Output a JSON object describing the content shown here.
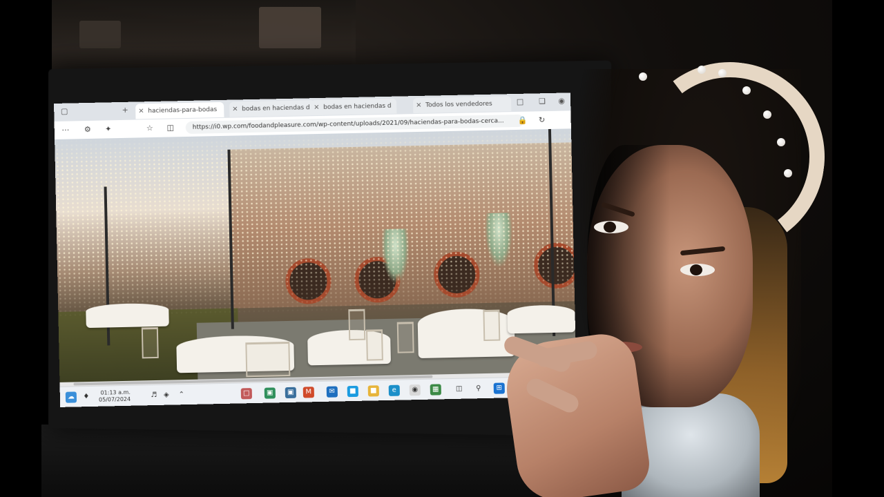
{
  "scene": {
    "description_type": "photo of a person holding a laptop displaying a browser",
    "background_color": "#0b0907"
  },
  "browser": {
    "tabs": [
      {
        "label": "haciendas-para-bodas",
        "close": "×",
        "active": true
      },
      {
        "label": "bodas en haciendas d",
        "close": "×",
        "active": false
      },
      {
        "label": "bodas en haciendas d",
        "close": "×",
        "active": false
      },
      {
        "label": "Todos los vendedores",
        "close": "×",
        "active": false
      }
    ],
    "new_tab": "+",
    "url": "https://i0.wp.com/foodandpleasure.com/wp-content/uploads/2021/09/haciendas-para-bodas-cerca...",
    "accent": "#0067c0"
  },
  "taskbar": {
    "clock_time": "01:13 a.m.",
    "clock_date": "05/07/2024",
    "icons": [
      "start-icon",
      "search-icon",
      "taskview-icon",
      "edge-icon",
      "explorer-icon",
      "store-icon",
      "mail-icon",
      "office-icon",
      "chrome-icon",
      "photos-icon",
      "terminal-icon"
    ]
  }
}
